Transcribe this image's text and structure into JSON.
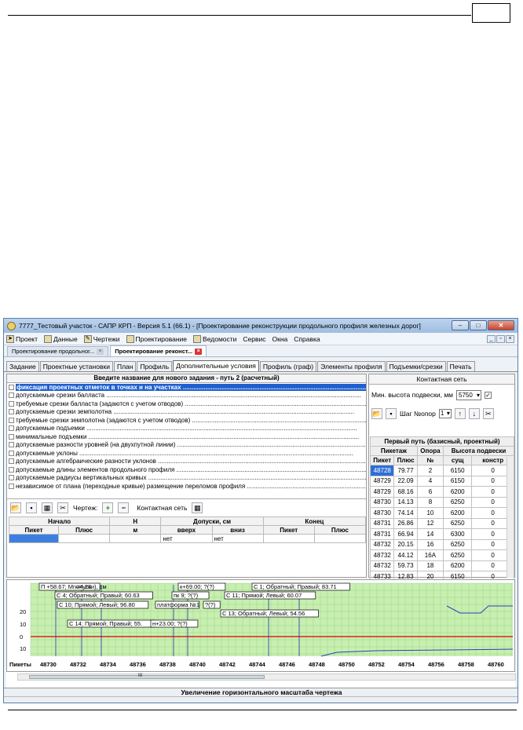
{
  "window": {
    "title": "7777_Тестовый участок - САПР КРП - Версия 5.1 (66.1) - [Проектирование реконструкции продольного профиля железных дорог]",
    "btn_min": "–",
    "btn_max": "□",
    "btn_close": "✕"
  },
  "menu": [
    {
      "label": "Проект",
      "icon": "arrow-icon"
    },
    {
      "label": "Данные",
      "icon": "folder-icon"
    },
    {
      "label": "Чертежи",
      "icon": "pen-icon"
    },
    {
      "label": "Проектирование",
      "icon": "chart-icon"
    },
    {
      "label": "Ведомости",
      "icon": "clipboard-icon"
    },
    {
      "label": "Сервис"
    },
    {
      "label": "Окна"
    },
    {
      "label": "Справка"
    }
  ],
  "doc_tabs": [
    {
      "label": "Проектирование продольног...",
      "close": "×"
    },
    {
      "label": "Проектирование реконст...",
      "close": "×"
    }
  ],
  "tabs": [
    "Задание",
    "Проектные установки",
    "План",
    "Профиль",
    "Дополнительные условия",
    "Профиль (граф)",
    "Элементы профиля",
    "Подъемки/срезки",
    "Печать"
  ],
  "active_tab": "Дополнительные условия",
  "left": {
    "header": "Введите название для нового задания -  путь 2 (расчетный)",
    "conditions": [
      "фиксация проектных отметок в точках и на участках .............................................................................................................................................................................................................................................",
      "допускаемые срезки балласта ..................................................................................................................................................",
      "требуемые срезки балласта  (задаются с учетом отводов) .....................................................................................................................",
      "допускаемые срезки земполотна ..........................................................................................................................................",
      "требуемые срезки земполотна  (задаются с учетом отводов) ..................................................................................................................",
      "допускаемые подъемки ...........................................................................................................................................................",
      "минимальные подъемки ...........................................................................................................................................................",
      "допускаемые разности уровней (на двухпутной линии) .............................................................................................................",
      "допускаемые уклоны .............................................................................................................................................................",
      "допускаемые алгебраические разности уклонов .......................................................................................................................",
      "допускаемые длины элементов продольного профиля ..............................................................................................................",
      "допускаемые радиусы вертикальных кривых .............................................................................................................................",
      "независимое от плана (переходные кривые) размещение переломов профиля ...................................................................................."
    ],
    "toolbar": {
      "drawing_label": "Чертеж:",
      "plus": "+",
      "minus": "−",
      "network_label": "Контактная сеть"
    },
    "grid": {
      "group_start": "Начало",
      "group_h": "Н",
      "group_tol": "Допуски, см",
      "group_end": "Конец",
      "cols": [
        "Пикет",
        "Плюс",
        "м",
        "вверх",
        "вниз",
        "Пикет",
        "Плюс"
      ],
      "row": [
        "",
        "",
        "",
        "нет",
        "нет",
        "",
        ""
      ]
    }
  },
  "right": {
    "title": "Контактная сеть",
    "min_height_label": "Мин. высота подвески, мм",
    "min_height_value": "5750",
    "checked": "✓",
    "step_label": "Шаг №опор",
    "step_value": "1",
    "section_title": "Первый путь (базисный, проектный)",
    "groups": [
      "Пикетаж",
      "Опора",
      "Высота подвески"
    ],
    "cols": [
      "Пикет",
      "Плюс",
      "№",
      "сущ",
      "констр"
    ],
    "rows": [
      [
        "48728",
        "79.77",
        "2",
        "6150",
        "0"
      ],
      [
        "48729",
        "22.09",
        "4",
        "6150",
        "0"
      ],
      [
        "48729",
        "68.16",
        "6",
        "6200",
        "0"
      ],
      [
        "48730",
        "14.13",
        "8",
        "6250",
        "0"
      ],
      [
        "48730",
        "74.14",
        "10",
        "6200",
        "0"
      ],
      [
        "48731",
        "26.86",
        "12",
        "6250",
        "0"
      ],
      [
        "48731",
        "66.94",
        "14",
        "6300",
        "0"
      ],
      [
        "48732",
        "20.15",
        "16",
        "6250",
        "0"
      ],
      [
        "48732",
        "44.12",
        "16А",
        "6250",
        "0"
      ],
      [
        "48732",
        "59.73",
        "18",
        "6200",
        "0"
      ],
      [
        "48733",
        "12.83",
        "20",
        "6150",
        "0"
      ]
    ]
  },
  "chart_data": {
    "type": "profile",
    "y_ticks": [
      "20",
      "10",
      "0",
      "10"
    ],
    "x_label": "Пикеты",
    "x_ticks": [
      "48730",
      "48732",
      "48734",
      "48736",
      "48738",
      "48740",
      "48742",
      "48744",
      "48746",
      "48748",
      "48750",
      "48752",
      "48754",
      "48756",
      "48758",
      "48760",
      "4876"
    ],
    "annotations": [
      "П +58.67; Mn=4.28",
      "опуски), см",
      "к+69.00; ?(?)",
      "С 1; Обратный; Правый; 83.71",
      "С 4; Обратный; Правый; 60.63",
      "пк 9; ?(?)",
      "С 11; Прямой; Левый; 60.07",
      "С 10; Прямой; Левый; 96.80",
      "платформа №1",
      "?(?)",
      "С 13; Обратный; Левый; 54.56",
      "С 14; Прямой; Правый; 55.",
      "н+23.00; ?(?)"
    ]
  },
  "scroll_label": "III",
  "status": "Увеличение горизонтального масштаба чертежа"
}
